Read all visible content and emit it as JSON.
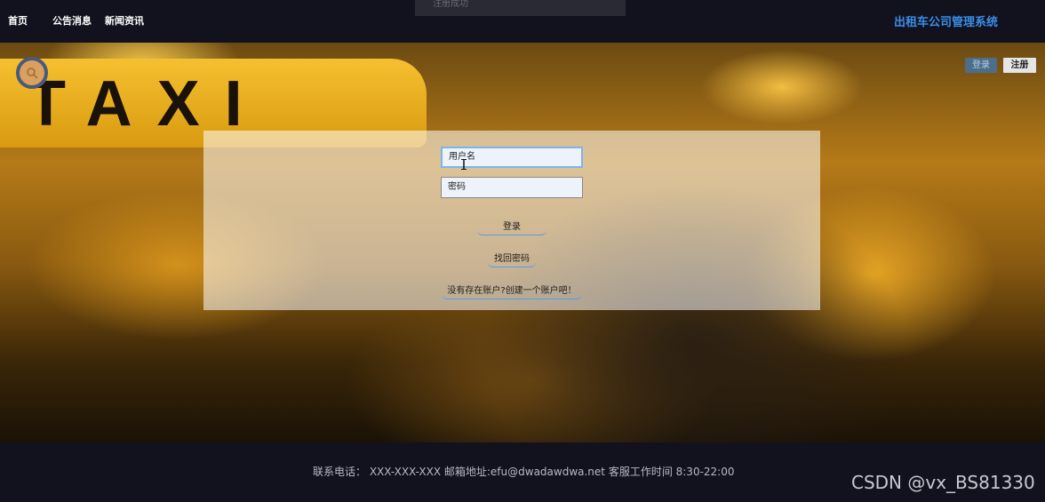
{
  "nav": {
    "items": [
      {
        "label": "首页"
      },
      {
        "label": "公告消息"
      },
      {
        "label": "新闻资讯"
      }
    ],
    "toast": "注册成功",
    "brand": "出租车公司管理系统"
  },
  "hero": {
    "sign_text": "TAXI",
    "login_button": "登录",
    "register_button": "注册"
  },
  "login_form": {
    "username_placeholder": "用户名",
    "password_placeholder": "密码",
    "submit_label": "登录",
    "forgot_label": "找回密码",
    "create_label": "没有存在账户?创建一个账户吧！"
  },
  "footer": {
    "contact": "联系电话： XXX-XXX-XXX 邮箱地址:efu@dwadawdwa.net 客服工作时间 8:30-22:00",
    "watermark": "CSDN @vx_BS81330"
  },
  "colors": {
    "topbar": "#12121f",
    "brand": "#3a8ee6",
    "accent_link": "#5a9ae6"
  }
}
